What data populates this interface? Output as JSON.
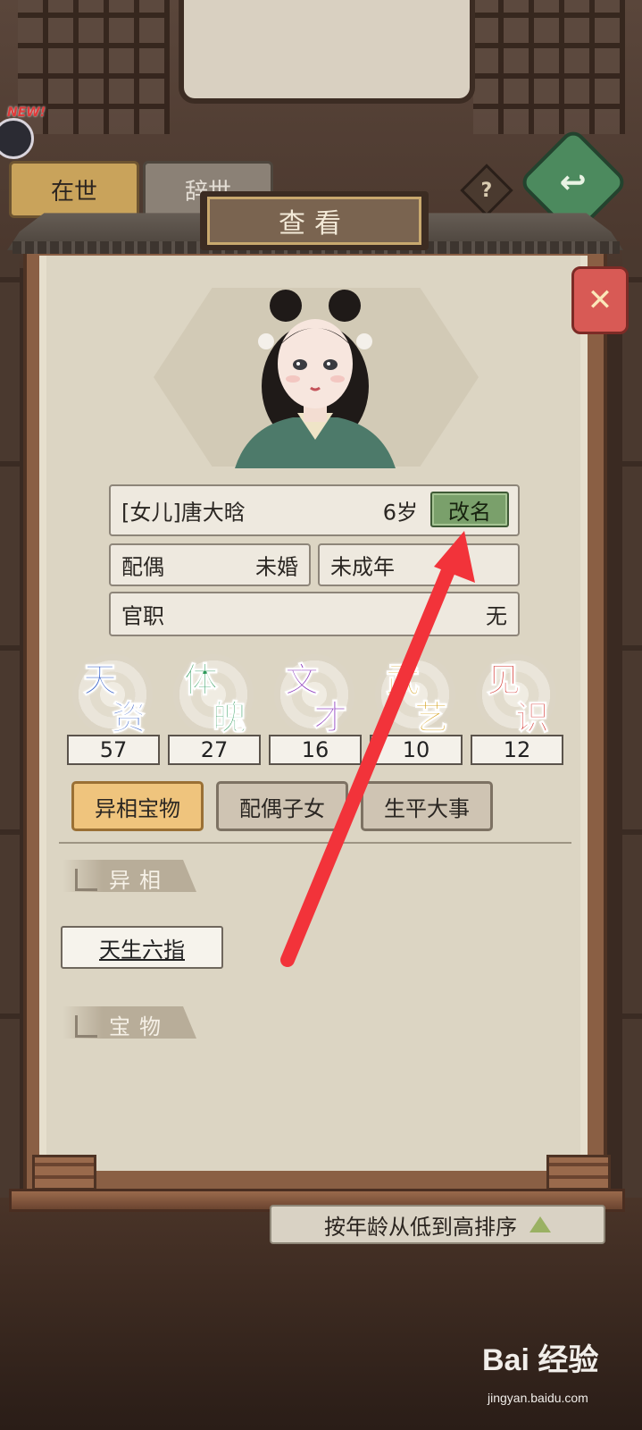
{
  "top_tabs": {
    "alive": "在世",
    "deceased": "辞世"
  },
  "new_badge": "NEW!",
  "help_icon_glyph": "?",
  "back_icon_glyph": "↩",
  "dialog": {
    "title": "查看",
    "close_glyph": "✕"
  },
  "character": {
    "name": "[女儿]唐大晗",
    "age": "6岁",
    "rename_label": "改名",
    "spouse_label": "配偶",
    "spouse_value": "未婚",
    "status": "未成年",
    "office_label": "官职",
    "office_value": "无"
  },
  "stats": [
    {
      "c1": "天",
      "c2": "资",
      "value": "57",
      "color": "#3a63c9"
    },
    {
      "c1": "体",
      "c2": "魄",
      "value": "27",
      "color": "#2d9a5a"
    },
    {
      "c1": "文",
      "c2": "才",
      "value": "16",
      "color": "#8d3bbd"
    },
    {
      "c1": "武",
      "c2": "艺",
      "value": "10",
      "color": "#d6a21e"
    },
    {
      "c1": "见",
      "c2": "识",
      "value": "12",
      "color": "#d7443f"
    }
  ],
  "sub_tabs": [
    "异相宝物",
    "配偶子女",
    "生平大事"
  ],
  "sections": {
    "traits_title": "异相",
    "traits": [
      "天生六指"
    ],
    "treasures_title": "宝物"
  },
  "sort_bar": "按年龄从低到高排序",
  "watermark": {
    "brand": "Bai 经验",
    "url": "jingyan.baidu.com"
  },
  "colors": {
    "accent_red_arrow": "#f2333a",
    "rename_green": "#7aa06b",
    "active_tab": "#efc47d"
  }
}
